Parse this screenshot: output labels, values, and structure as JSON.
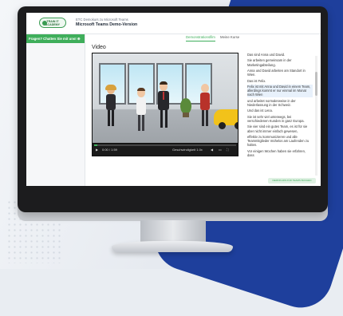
{
  "header": {
    "logo_line1": "TRAIN IT",
    "logo_line2": "ACADEMY",
    "course_subtitle": "ETC Demokurs zu Microsoft Teams",
    "course_title": "Microsoft Teams Demo-Version"
  },
  "sidebar": {
    "button_label": "Fragen? Chatten Sie mit uns! ⊕"
  },
  "tabs": [
    {
      "label": "Demonstrationsfilm",
      "active": true
    },
    {
      "label": "Meine Kurse",
      "active": false
    }
  ],
  "video": {
    "heading": "Video",
    "time": "0:00 / 1:59",
    "speed_label": "Geschwindigkeit 1.0x",
    "progress": 0.02
  },
  "transcript": [
    "Das sind Anna und David.",
    "Sie arbeiten gemeinsam in der Marketingabteilung.",
    "Anna und David arbeiten am Standort in Wien.",
    "Das ist Felix.",
    "Felix ist mit Anna und David in einem Team, allerdings kommt er nur einmal im Monat nach Wien",
    "und arbeitet normalerweise in der Niederlassung in der Schweiz.",
    "Und das ist Lena.",
    "Sie ist sehr viel unterwegs, bei verschiedenen Kunden in ganz Europa.",
    "Sie vier sind ein gutes Team, es ist für sie aber nicht immer einfach gewesen,",
    "effektiv zu kommunizieren und alle Teammitglieder mühelos am Laufenden zu halten.",
    "Vor einigen Wochen haben sie erfahren, dass"
  ],
  "cta_label": "DEMOKURS FÜR TEAMS BUCHEN",
  "colors": {
    "accent": "#3fae5b",
    "brand_blue": "#1e3f9c"
  }
}
